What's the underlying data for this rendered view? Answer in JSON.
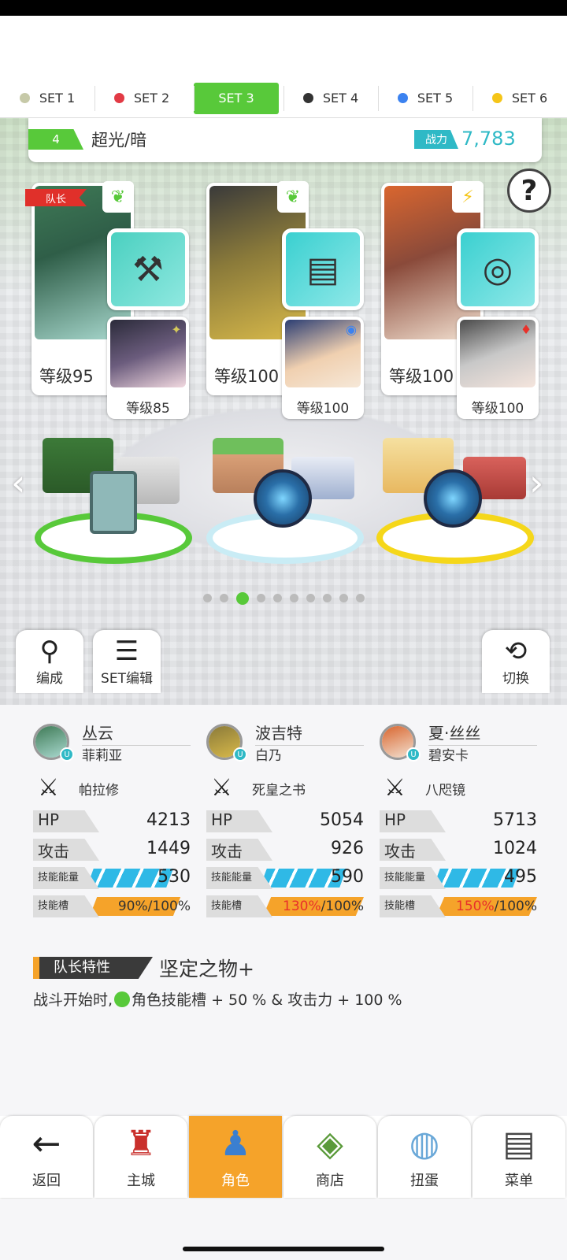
{
  "tabs": [
    {
      "label": "SET 1",
      "color": "#c6c9a8"
    },
    {
      "label": "SET 2",
      "color": "#e23a45"
    },
    {
      "label": "SET 3",
      "color": "#58c93a"
    },
    {
      "label": "SET 4",
      "color": "#333333"
    },
    {
      "label": "SET 5",
      "color": "#3b82f0"
    },
    {
      "label": "SET 6",
      "color": "#f5c518"
    }
  ],
  "active_tab": "SET 3",
  "team": {
    "number": "4",
    "name": "超光/暗",
    "power_label": "战力",
    "power_value": "7,783"
  },
  "help_icon": "?",
  "cards": [
    {
      "leader_label": "队长",
      "level": "等级95",
      "sub_level": "等级85",
      "element": "leaf-icon",
      "equip": "axe-icon"
    },
    {
      "level": "等级100",
      "sub_level": "等级100",
      "element": "leaf-icon",
      "equip": "book-icon"
    },
    {
      "level": "等级100",
      "sub_level": "等级100",
      "element": "lightning-icon",
      "equip": "mirror-icon"
    }
  ],
  "carousel": {
    "count": 10,
    "active": 3
  },
  "toolbar": {
    "formation_label": "编成",
    "set_edit_label": "SET编辑",
    "switch_label": "切换"
  },
  "members": [
    {
      "name": "丛云",
      "partner": "菲莉亚",
      "weapon": "帕拉修",
      "hp": "4213",
      "atk": "1449",
      "skill_energy": "530",
      "skill_slot_value": "90",
      "skill_slot_max": "/100",
      "skill_slot_fill": 0.9
    },
    {
      "name": "波吉特",
      "partner": "白乃",
      "weapon": "死皇之书",
      "hp": "5054",
      "atk": "926",
      "skill_energy": "590",
      "skill_slot_value": "130",
      "skill_slot_max": "/100",
      "skill_slot_fill": 1.0
    },
    {
      "name": "夏·丝丝",
      "partner": "碧安卡",
      "weapon": "八咫镜",
      "hp": "5713",
      "atk": "1024",
      "skill_energy": "495",
      "skill_slot_value": "150",
      "skill_slot_max": "/100",
      "skill_slot_fill": 1.0
    }
  ],
  "stat_labels": {
    "hp": "HP",
    "atk": "攻击",
    "energy": "技能能量",
    "slot": "技能槽",
    "percent": "%"
  },
  "leader_skill": {
    "tag": "队长特性",
    "name": "坚定之物+",
    "desc_pre": "战斗开始时,",
    "desc_post": "角色技能槽 + 50 % & 攻击力 + 100 %"
  },
  "nav": [
    {
      "label": "返回",
      "icon": "back-arrow-icon"
    },
    {
      "label": "主城",
      "icon": "castle-icon"
    },
    {
      "label": "角色",
      "icon": "character-icon"
    },
    {
      "label": "商店",
      "icon": "shop-icon"
    },
    {
      "label": "扭蛋",
      "icon": "gacha-icon"
    },
    {
      "label": "菜单",
      "icon": "menu-icon"
    }
  ],
  "active_nav": "角色"
}
